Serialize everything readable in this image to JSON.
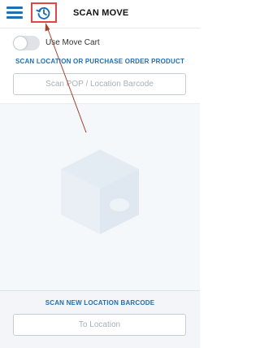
{
  "header": {
    "title": "SCAN MOVE",
    "menu_icon": "hamburger-menu-icon",
    "history_icon": "history-icon"
  },
  "toggle": {
    "label": "Use Move Cart",
    "on": false
  },
  "scan_product": {
    "label": "SCAN LOCATION OR PURCHASE ORDER PRODUCT",
    "placeholder": "Scan POP / Location Barcode",
    "value": ""
  },
  "empty_state": {
    "icon": "box-icon"
  },
  "scan_location": {
    "label": "SCAN NEW LOCATION BARCODE",
    "placeholder": "To Location",
    "value": ""
  },
  "colors": {
    "accent": "#1f6fb3",
    "highlight": "#e04646",
    "panel": "#f3f5f8"
  }
}
